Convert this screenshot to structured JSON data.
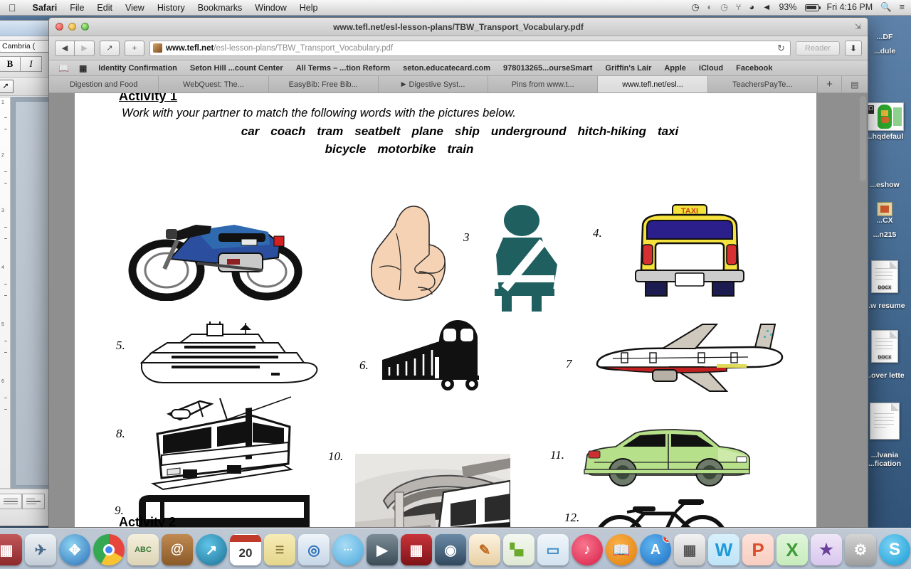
{
  "menubar": {
    "apple_icon": "apple-icon",
    "items": [
      {
        "label": "Safari",
        "bold": true
      },
      {
        "label": "File",
        "bold": false
      },
      {
        "label": "Edit",
        "bold": false
      },
      {
        "label": "View",
        "bold": false
      },
      {
        "label": "History",
        "bold": false
      },
      {
        "label": "Bookmarks",
        "bold": false
      },
      {
        "label": "Window",
        "bold": false
      },
      {
        "label": "Help",
        "bold": false
      }
    ],
    "status": {
      "battery_percent": "93%",
      "datetime": "Fri 4:16 PM",
      "icons": [
        "clock-check-icon",
        "activity-icon",
        "time-machine-icon",
        "bluetooth-icon",
        "wifi-icon",
        "volume-icon",
        "battery-icon",
        "search-icon",
        "notification-center-icon"
      ]
    }
  },
  "safari": {
    "window_title": "www.tefl.net/esl-lesson-plans/TBW_Transport_Vocabulary.pdf",
    "toolbar": {
      "back_icon": "back-arrow-icon",
      "forward_icon": "forward-arrow-icon",
      "share_icon": "share-icon",
      "newtab_label": "+",
      "url_host": "www.tefl.net",
      "url_path": "/esl-lesson-plans/TBW_Transport_Vocabulary.pdf",
      "reload_icon": "reload-icon",
      "reader_label": "Reader",
      "download_icon": "download-icon",
      "fullscreen_icon": "fullscreen-icon"
    },
    "bookmarks_bar": [
      {
        "label": "Identity Confirmation"
      },
      {
        "label": "Seton Hill ...count Center"
      },
      {
        "label": "All Terms – ...tion Reform"
      },
      {
        "label": "seton.educatecard.com"
      },
      {
        "label": "978013265...ourseSmart"
      },
      {
        "label": "Griffin's Lair"
      },
      {
        "label": "Apple"
      },
      {
        "label": "iCloud"
      },
      {
        "label": "Facebook"
      }
    ],
    "tabs": [
      {
        "label": "Digestion and Food",
        "active": false,
        "playing": false
      },
      {
        "label": "WebQuest: The...",
        "active": false,
        "playing": false
      },
      {
        "label": "EasyBib: Free Bib...",
        "active": false,
        "playing": false
      },
      {
        "label": "Digestive Syst...",
        "active": false,
        "playing": true
      },
      {
        "label": "Pins from www.t...",
        "active": false,
        "playing": false
      },
      {
        "label": "www.tefl.net/esl...",
        "active": true,
        "playing": false
      },
      {
        "label": "TeachersPayTe...",
        "active": false,
        "playing": false
      }
    ],
    "tab_new_label": "+",
    "tab_overview_icon": "tab-overview-icon"
  },
  "pdf": {
    "activity1_heading": "Activity 1",
    "instruction": "Work with your partner to match the following words with the pictures below.",
    "word_row1": [
      "car",
      "coach",
      "tram",
      "seatbelt",
      "plane",
      "ship",
      "underground",
      "hitch-hiking",
      "taxi"
    ],
    "word_row2": [
      "bicycle",
      "motorbike",
      "train"
    ],
    "activity2_heading": "Activity 2",
    "items": [
      {
        "number": "",
        "picture": "motorbike-picture"
      },
      {
        "number": "",
        "picture": "thumb-up-hitchhiking-picture"
      },
      {
        "number": "3",
        "picture": "seatbelt-picture"
      },
      {
        "number": "4.",
        "picture": "taxi-picture"
      },
      {
        "number": "5.",
        "picture": "ship-cruise-picture"
      },
      {
        "number": "6.",
        "picture": "train-picture"
      },
      {
        "number": "7",
        "picture": "plane-picture"
      },
      {
        "number": "8.",
        "picture": "tram-picture"
      },
      {
        "number": "9.",
        "picture": "coach-bus-picture"
      },
      {
        "number": "10.",
        "picture": "underground-station-picture"
      },
      {
        "number": "11.",
        "picture": "car-picture"
      },
      {
        "number": "12.",
        "picture": "bicycle-picture"
      }
    ]
  },
  "word_window": {
    "font_name": "Cambria (",
    "bold_label": "B",
    "italic_label": "I"
  },
  "desktop_icons": [
    {
      "label": "...DF",
      "kind": "text"
    },
    {
      "label": "...dule",
      "kind": "text"
    },
    {
      "label": "...hqdefaul",
      "kind": "thumb-human-body"
    },
    {
      "label": "...eshow",
      "kind": "text"
    },
    {
      "label": "...CX",
      "kind": "thumb-small"
    },
    {
      "label": "...n215",
      "kind": "text"
    },
    {
      "label": "DOCX",
      "kind": "doc"
    },
    {
      "label": "...w resume",
      "kind": "text"
    },
    {
      "label": "DOCX",
      "kind": "doc"
    },
    {
      "label": "...over lette",
      "kind": "text"
    },
    {
      "label": "...lvania",
      "kind": "thumb-page"
    },
    {
      "label": "...fication",
      "kind": "text"
    }
  ],
  "dock": {
    "items": [
      {
        "name": "finder",
        "glyph": "☺",
        "bg": "#7fb4e0",
        "round": false
      },
      {
        "name": "launchpad",
        "glyph": "🚀",
        "bg": "#c8ccd1",
        "round": true
      },
      {
        "name": "mission-control",
        "glyph": "▭",
        "bg": "#a4383a",
        "round": false
      },
      {
        "name": "mail-stamp",
        "glyph": "✉",
        "bg": "#cfd8e2",
        "round": false
      },
      {
        "name": "safari",
        "glyph": "⌖",
        "bg": "#3f7fd0",
        "round": true
      },
      {
        "name": "chrome",
        "glyph": "◉",
        "bg": "#e8453c",
        "round": true
      },
      {
        "name": "dictionary",
        "glyph": "ABC",
        "bg": "#e9e4d2",
        "round": false
      },
      {
        "name": "contacts",
        "glyph": "@",
        "bg": "#a97a4a",
        "round": false
      },
      {
        "name": "stocks",
        "glyph": "↗",
        "bg": "#2a8fb8",
        "round": true
      },
      {
        "name": "calendar",
        "glyph": "20",
        "bg": "#ffffff",
        "round": false
      },
      {
        "name": "notes",
        "glyph": "≡",
        "bg": "#f2e2a0",
        "round": false
      },
      {
        "name": "app-store-alt",
        "glyph": "▣",
        "bg": "#dfe7ef",
        "round": false
      },
      {
        "name": "messages",
        "glyph": "●●●",
        "bg": "#6fc0ea",
        "round": true
      },
      {
        "name": "facetime",
        "glyph": "▶",
        "bg": "#5a6a74",
        "round": false
      },
      {
        "name": "photo-booth",
        "glyph": "▦",
        "bg": "#b8262b",
        "round": false
      },
      {
        "name": "image-capture",
        "glyph": "☉",
        "bg": "#46627c",
        "round": false
      },
      {
        "name": "pages",
        "glyph": "✎",
        "bg": "#f0a040",
        "round": false
      },
      {
        "name": "numbers",
        "glyph": "▌▐",
        "bg": "#8cc63f",
        "round": false
      },
      {
        "name": "keynote",
        "glyph": "▭",
        "bg": "#5fa8d8",
        "round": false
      },
      {
        "name": "itunes",
        "glyph": "♫",
        "bg": "#ec2f56",
        "round": true
      },
      {
        "name": "ibooks",
        "glyph": "📖",
        "bg": "#f28f1e",
        "round": true
      },
      {
        "name": "app-store",
        "glyph": "A",
        "bg": "#2a8ae0",
        "round": true,
        "badge": "1"
      },
      {
        "name": "scanner",
        "glyph": "☷",
        "bg": "#d7d7d7",
        "round": false
      },
      {
        "name": "microsoft-word",
        "glyph": "W",
        "bg": "#2aa6e0",
        "round": false
      },
      {
        "name": "microsoft-powerpoint",
        "glyph": "P",
        "bg": "#e2553a",
        "round": false
      },
      {
        "name": "microsoft-excel",
        "glyph": "X",
        "bg": "#49a942",
        "round": false
      },
      {
        "name": "imovie",
        "glyph": "★",
        "bg": "#7a4fa0",
        "round": false
      },
      {
        "name": "system-preferences",
        "glyph": "⚙",
        "bg": "#9a9a9a",
        "round": false
      },
      {
        "name": "skype",
        "glyph": "S",
        "bg": "#2bb3e8",
        "round": true
      },
      {
        "name": "separator",
        "glyph": "",
        "bg": "",
        "round": false
      },
      {
        "name": "downloads-stack",
        "glyph": "▤",
        "bg": "#e8e8e8",
        "round": false
      },
      {
        "name": "trash",
        "glyph": "▓",
        "bg": "#cfcfcf",
        "round": false
      }
    ]
  },
  "colors": {
    "desktop": "#4b6f95",
    "pdf_page": "#ffffff",
    "taxi_yellow": "#f5e23c",
    "car_green": "#b7e08a",
    "seatbelt_teal": "#1f5f5f",
    "motorbike_blue": "#2b4f9e"
  }
}
